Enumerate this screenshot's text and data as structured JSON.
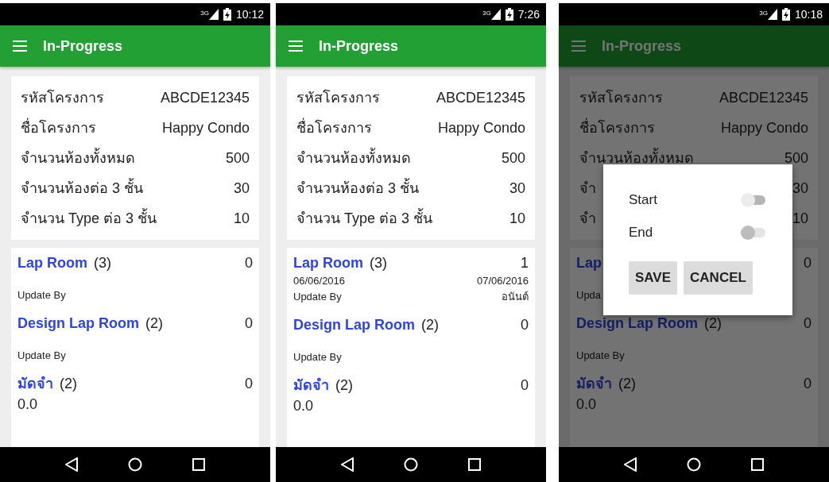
{
  "phones": [
    {
      "status": {
        "network": "3G",
        "time": "10:12"
      },
      "title": "In-Progress",
      "dimmed": false,
      "project": [
        {
          "label": "รหัสโครงการ",
          "value": "ABCDE12345"
        },
        {
          "label": "ชื่อโครงการ",
          "value": "Happy Condo"
        },
        {
          "label": "จำนวนห้องทั้งหมด",
          "value": "500"
        },
        {
          "label": "จำนวนห้องต่อ 3 ชั้น",
          "value": "30"
        },
        {
          "label": "จำนวน Type ต่อ 3 ชั้น",
          "value": "10"
        }
      ],
      "tasks": [
        {
          "name": "Lap Room",
          "count": "(3)",
          "value": "0",
          "update_label": "Update By"
        },
        {
          "name": "Design Lap Room",
          "count": "(2)",
          "value": "0",
          "update_label": "Update By"
        },
        {
          "name": "มัดจำ",
          "count": "(2)",
          "value": "0",
          "amount": "0.0"
        }
      ]
    },
    {
      "status": {
        "network": "3G",
        "time": "7:26"
      },
      "title": "In-Progress",
      "dimmed": false,
      "project": [
        {
          "label": "รหัสโครงการ",
          "value": "ABCDE12345"
        },
        {
          "label": "ชื่อโครงการ",
          "value": "Happy Condo"
        },
        {
          "label": "จำนวนห้องทั้งหมด",
          "value": "500"
        },
        {
          "label": "จำนวนห้องต่อ 3 ชั้น",
          "value": "30"
        },
        {
          "label": "จำนวน Type ต่อ 3 ชั้น",
          "value": "10"
        }
      ],
      "tasks": [
        {
          "name": "Lap Room",
          "count": "(3)",
          "value": "1",
          "start_date": "06/06/2016",
          "end_date": "07/06/2016",
          "update_label": "Update By",
          "updated_by": "อนันต์"
        },
        {
          "name": "Design Lap Room",
          "count": "(2)",
          "value": "0",
          "update_label": "Update By"
        },
        {
          "name": "มัดจำ",
          "count": "(2)",
          "value": "0",
          "amount": "0.0"
        }
      ]
    },
    {
      "status": {
        "network": "3G",
        "time": "10:18"
      },
      "title": "In-Progress",
      "dimmed": true,
      "project": [
        {
          "label": "รหัสโครงการ",
          "value": "ABCDE12345"
        },
        {
          "label": "ชื่อโครงการ",
          "value": "Happy Condo"
        },
        {
          "label": "จำนวนห้องทั้งหมด",
          "value": "500"
        },
        {
          "label": "จำ",
          "value": "30"
        },
        {
          "label": "จำ",
          "value": "10"
        }
      ],
      "tasks": [
        {
          "name": "Lap",
          "value": "0",
          "update_label": "Upda"
        },
        {
          "name": "Design Lap Room",
          "count": "(2)",
          "value": "0",
          "update_label": "Update By"
        },
        {
          "name": "มัดจำ",
          "count": "(2)",
          "value": "0",
          "amount": "0.0"
        }
      ],
      "dialog": {
        "switches": [
          {
            "label": "Start",
            "on": false,
            "disabled": false
          },
          {
            "label": "End",
            "on": false,
            "disabled": true
          }
        ],
        "buttons": [
          "SAVE",
          "CANCEL"
        ]
      }
    }
  ]
}
